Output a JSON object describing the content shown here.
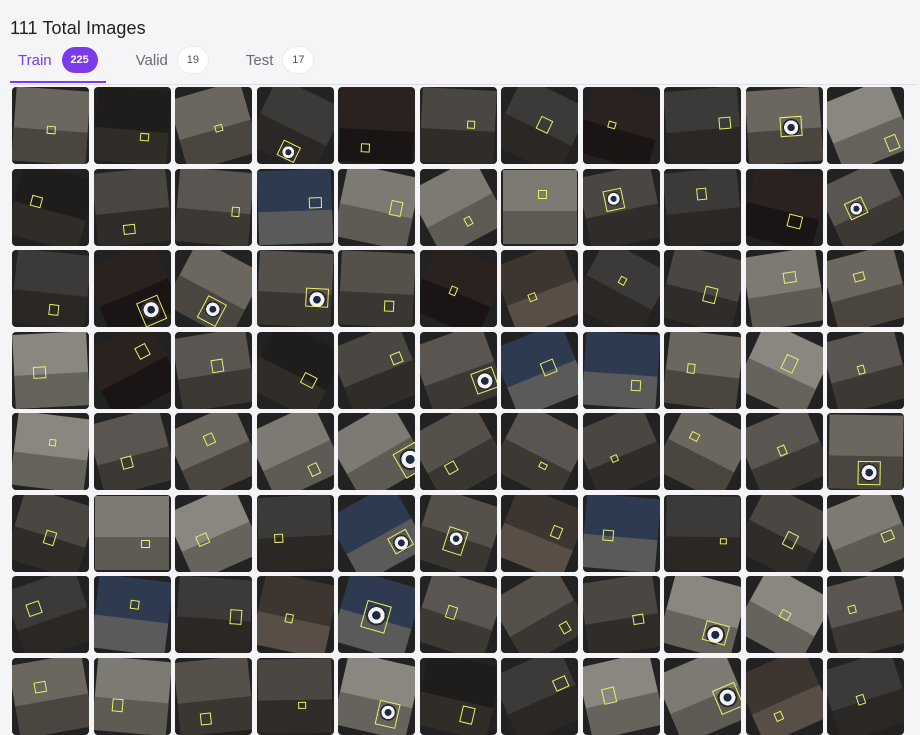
{
  "header": {
    "title": "111 Total Images"
  },
  "tabs": [
    {
      "label": "Train",
      "count": "225",
      "active": true
    },
    {
      "label": "Valid",
      "count": "19",
      "active": false
    },
    {
      "label": "Test",
      "count": "17",
      "active": false
    }
  ],
  "colors": {
    "accent": "#7c3aed",
    "annotation_box": "#e9f06a"
  },
  "grid": {
    "columns": 11,
    "visible_rows": 8
  }
}
